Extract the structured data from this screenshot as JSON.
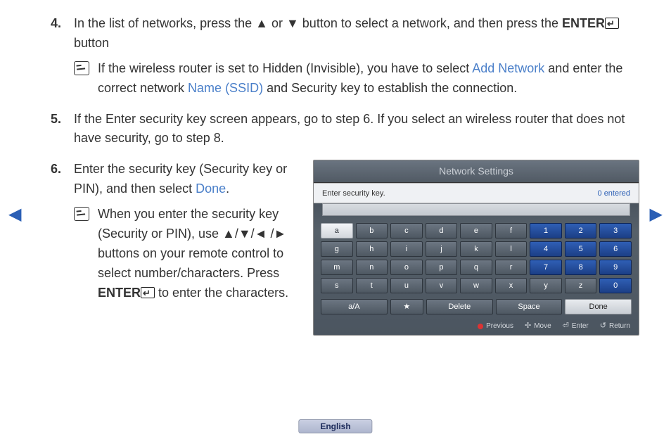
{
  "steps": {
    "s4": {
      "num": "4.",
      "text_a": "In the list of networks, press the ",
      "up": "▲",
      "or": " or ",
      "down": "▼",
      "text_b": " button to select a network, and then press the ",
      "enter": "ENTER",
      "enter_glyph": "E",
      "text_c": " button",
      "note_a": "If the wireless router is set to Hidden (Invisible), you have to select ",
      "note_link1": "Add Network",
      "note_b": " and enter the correct network ",
      "note_link2": "Name (SSID)",
      "note_c": " and Security key to establish the connection."
    },
    "s5": {
      "num": "5.",
      "text": "If the Enter security key screen appears, go to step 6. If you select an wireless router that does not have security, go to step 8."
    },
    "s6": {
      "num": "6.",
      "text_a": "Enter the security key (Security key or PIN), and then select ",
      "link_done": "Done",
      "text_b": ".",
      "note_a": "When you enter the security key (Security or PIN), use ",
      "arrows": "▲/▼/◄ /►",
      "note_b": " buttons on your remote control to select number/characters. Press ",
      "enter": "ENTER",
      "enter_glyph": "E",
      "note_c": " to enter the characters."
    }
  },
  "keyboard": {
    "title": "Network Settings",
    "prompt": "Enter security key.",
    "entered": "0 entered",
    "rows": [
      [
        "a",
        "b",
        "c",
        "d",
        "e",
        "f",
        "1",
        "2",
        "3"
      ],
      [
        "g",
        "h",
        "i",
        "j",
        "k",
        "l",
        "4",
        "5",
        "6"
      ],
      [
        "m",
        "n",
        "o",
        "p",
        "q",
        "r",
        "7",
        "8",
        "9"
      ],
      [
        "s",
        "t",
        "u",
        "v",
        "w",
        "x",
        "y",
        "z",
        "0"
      ]
    ],
    "bottom": {
      "case": "a/A",
      "star": "★",
      "delete": "Delete",
      "space": "Space",
      "done": "Done"
    },
    "hints": {
      "prev": "Previous",
      "move": "Move",
      "enter": "Enter",
      "return": "Return"
    }
  },
  "nav": {
    "left": "◀",
    "right": "▶"
  },
  "lang": "English"
}
